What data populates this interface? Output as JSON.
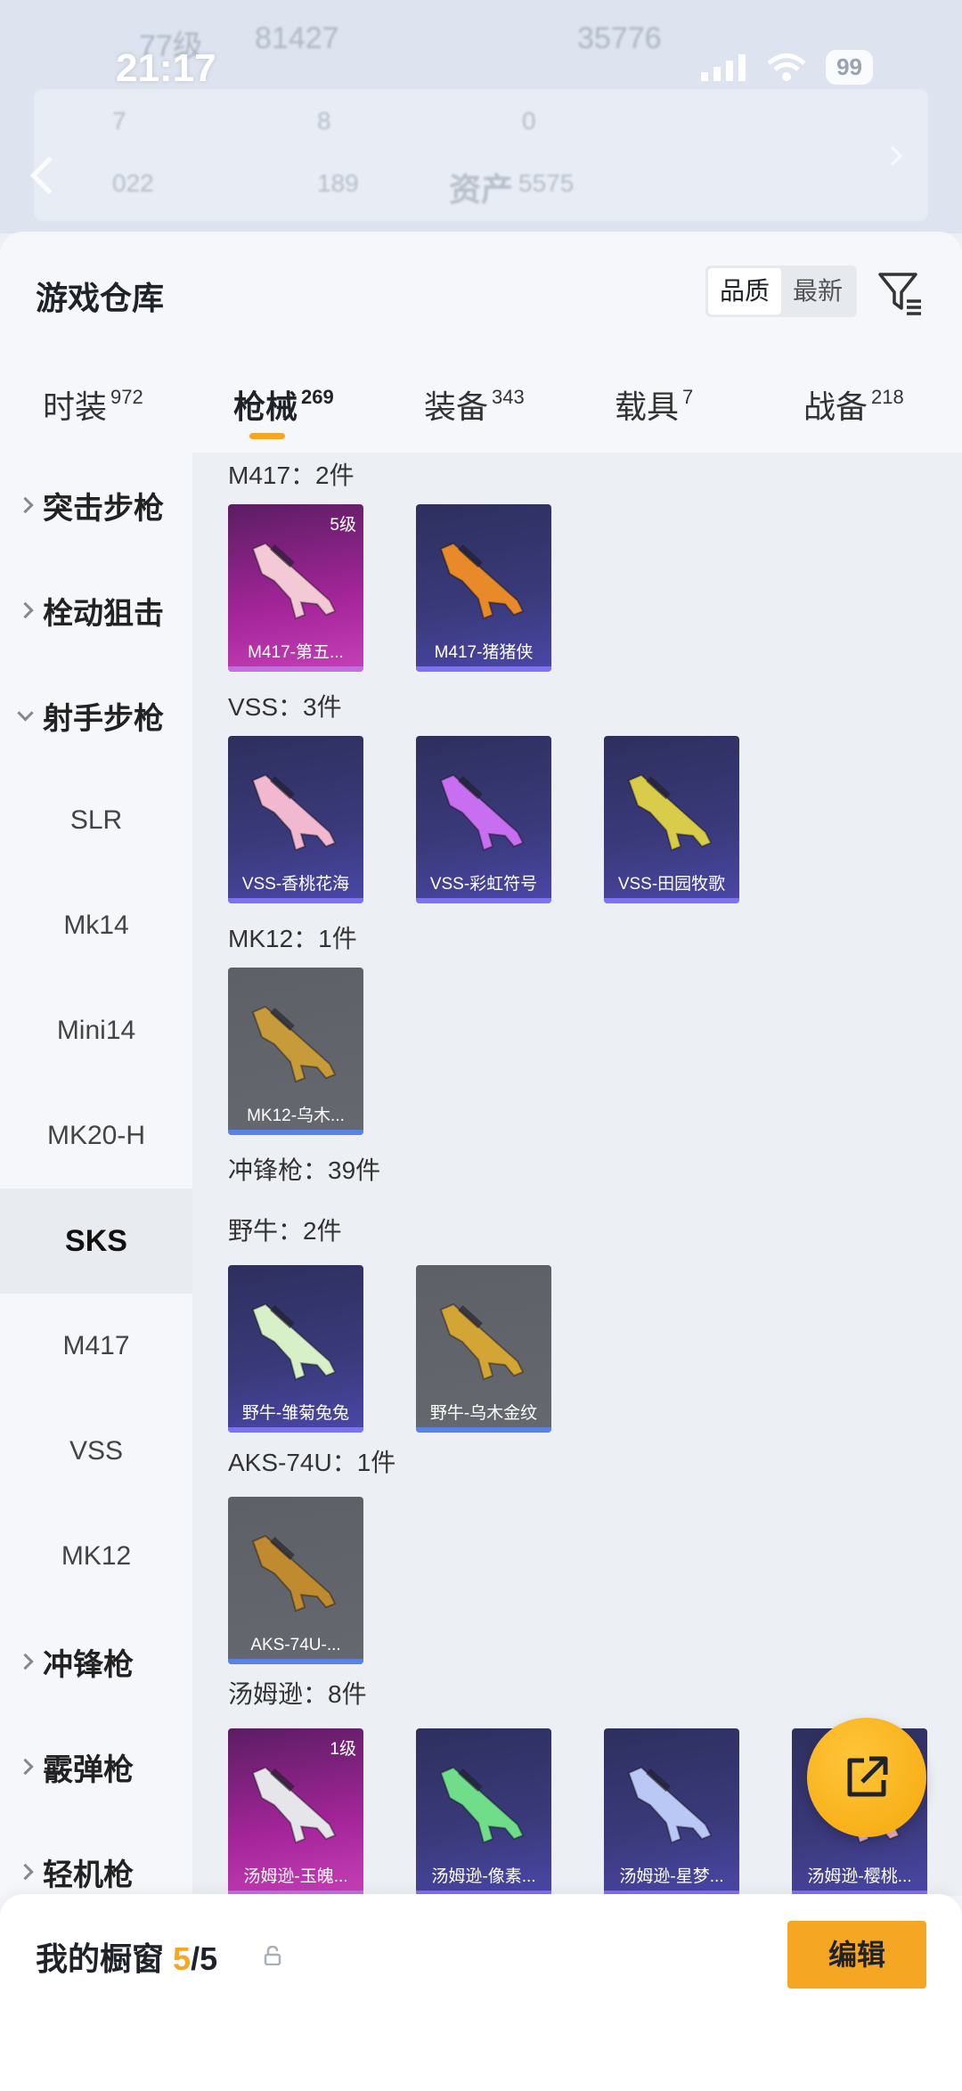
{
  "status_bar": {
    "time": "21:17",
    "battery": "99"
  },
  "background_stats": {
    "level": "77级",
    "views": "81427",
    "count": "35776",
    "assets_label": "资产",
    "assets_value": "5575",
    "s1": "7",
    "s2": "8",
    "s3": "0",
    "s4": "022",
    "s5": "189"
  },
  "header": {
    "title": "游戏仓库",
    "sort_quality": "品质",
    "sort_latest": "最新"
  },
  "tabs": [
    {
      "label": "时装",
      "count": "972"
    },
    {
      "label": "枪械",
      "count": "269"
    },
    {
      "label": "装备",
      "count": "343"
    },
    {
      "label": "载具",
      "count": "7"
    },
    {
      "label": "战备",
      "count": "218"
    }
  ],
  "sidebar": [
    {
      "label": "突击步枪"
    },
    {
      "label": "栓动狙击"
    },
    {
      "label": "射手步枪"
    },
    {
      "label": "SLR"
    },
    {
      "label": "Mk14"
    },
    {
      "label": "Mini14"
    },
    {
      "label": "MK20-H"
    },
    {
      "label": "SKS"
    },
    {
      "label": "M417"
    },
    {
      "label": "VSS"
    },
    {
      "label": "MK12"
    },
    {
      "label": "冲锋枪"
    },
    {
      "label": "霰弹枪"
    },
    {
      "label": "轻机枪"
    }
  ],
  "groups": [
    {
      "label": "M417：2件",
      "items": [
        {
          "name": "M417-第五...",
          "level": "5级",
          "rarity": "pink",
          "color": "#f3c9d6"
        },
        {
          "name": "M417-猪猪侠",
          "level": "",
          "rarity": "purple",
          "color": "#e88a2a"
        }
      ]
    },
    {
      "label": "VSS：3件",
      "items": [
        {
          "name": "VSS-香桃花海",
          "level": "",
          "rarity": "purple",
          "color": "#f2b8d0"
        },
        {
          "name": "VSS-彩虹符号",
          "level": "",
          "rarity": "purple",
          "color": "#c86ef0"
        },
        {
          "name": "VSS-田园牧歌",
          "level": "",
          "rarity": "purple",
          "color": "#d8cc4a"
        }
      ]
    },
    {
      "label": "MK12：1件",
      "items": [
        {
          "name": "MK12-乌木...",
          "level": "",
          "rarity": "grey",
          "color": "#c79b3a"
        }
      ]
    },
    {
      "label": "冲锋枪：39件",
      "items": []
    },
    {
      "label": "野牛：2件",
      "items": [
        {
          "name": "野牛-雏菊兔兔",
          "level": "",
          "rarity": "purple",
          "color": "#d8f0c8"
        },
        {
          "name": "野牛-乌木金纹",
          "level": "",
          "rarity": "grey",
          "color": "#d3a535"
        }
      ]
    },
    {
      "label": "AKS-74U：1件",
      "items": [
        {
          "name": "AKS-74U-...",
          "level": "",
          "rarity": "grey",
          "color": "#c08a2e"
        }
      ]
    },
    {
      "label": "汤姆逊：8件",
      "items": [
        {
          "name": "汤姆逊-玉魄...",
          "level": "1级",
          "rarity": "pink",
          "color": "#e6e6ea"
        },
        {
          "name": "汤姆逊-像素...",
          "level": "",
          "rarity": "purple",
          "color": "#6fdd8a"
        },
        {
          "name": "汤姆逊-星梦...",
          "level": "",
          "rarity": "purple",
          "color": "#b9c8f5"
        },
        {
          "name": "汤姆逊-樱桃...",
          "level": "",
          "rarity": "purple",
          "color": "#f0b6c8"
        }
      ]
    }
  ],
  "showcase": {
    "label": "我的橱窗",
    "current": "5",
    "sep_total": "/5",
    "edit_label": "编辑"
  },
  "colors": {
    "accent": "#f5a623"
  }
}
